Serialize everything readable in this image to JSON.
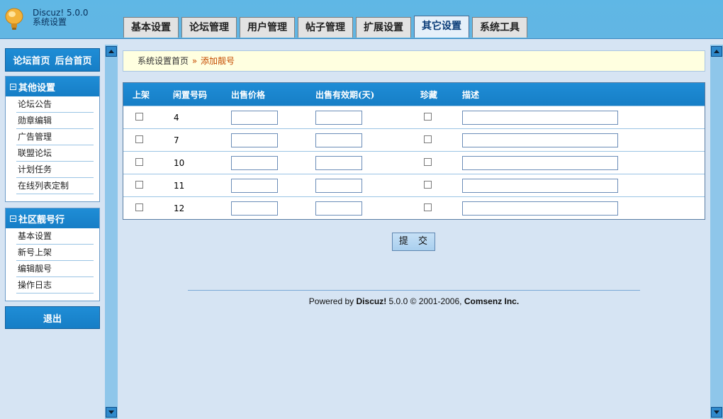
{
  "header": {
    "product": "Discuz! 5.0.0",
    "subtitle": "系统设置",
    "tabs": [
      {
        "label": "基本设置",
        "active": false
      },
      {
        "label": "论坛管理",
        "active": false
      },
      {
        "label": "用户管理",
        "active": false
      },
      {
        "label": "帖子管理",
        "active": false
      },
      {
        "label": "扩展设置",
        "active": false
      },
      {
        "label": "其它设置",
        "active": true
      },
      {
        "label": "系统工具",
        "active": false
      }
    ]
  },
  "sidebar": {
    "top_links": [
      "论坛首页",
      "后台首页"
    ],
    "menus": [
      {
        "title": "其他设置",
        "items": [
          "论坛公告",
          "勋章编辑",
          "广告管理",
          "联盟论坛",
          "计划任务",
          "在线列表定制"
        ]
      },
      {
        "title": "社区靓号行",
        "items": [
          "基本设置",
          "新号上架",
          "编辑靓号",
          "操作日志"
        ]
      }
    ],
    "logout": "退出"
  },
  "breadcrumb": {
    "home": "系统设置首页",
    "separator": "»",
    "current": "添加靓号"
  },
  "table": {
    "columns": [
      "上架",
      "闲置号码",
      "出售价格",
      "出售有效期(天)",
      "珍藏",
      "描述"
    ],
    "rows": [
      {
        "number": "4"
      },
      {
        "number": "7"
      },
      {
        "number": "10"
      },
      {
        "number": "11"
      },
      {
        "number": "12"
      }
    ]
  },
  "submit_label": "提 交",
  "footer": {
    "powered": "Powered by",
    "brand": "Discuz!",
    "version": "5.0.0",
    "copyright": "© 2001-2006,",
    "company": "Comsenz Inc."
  },
  "colors": {
    "header_bg": "#5fb7e5",
    "accent": "#167ec6",
    "crumb_current": "#c54b00"
  }
}
